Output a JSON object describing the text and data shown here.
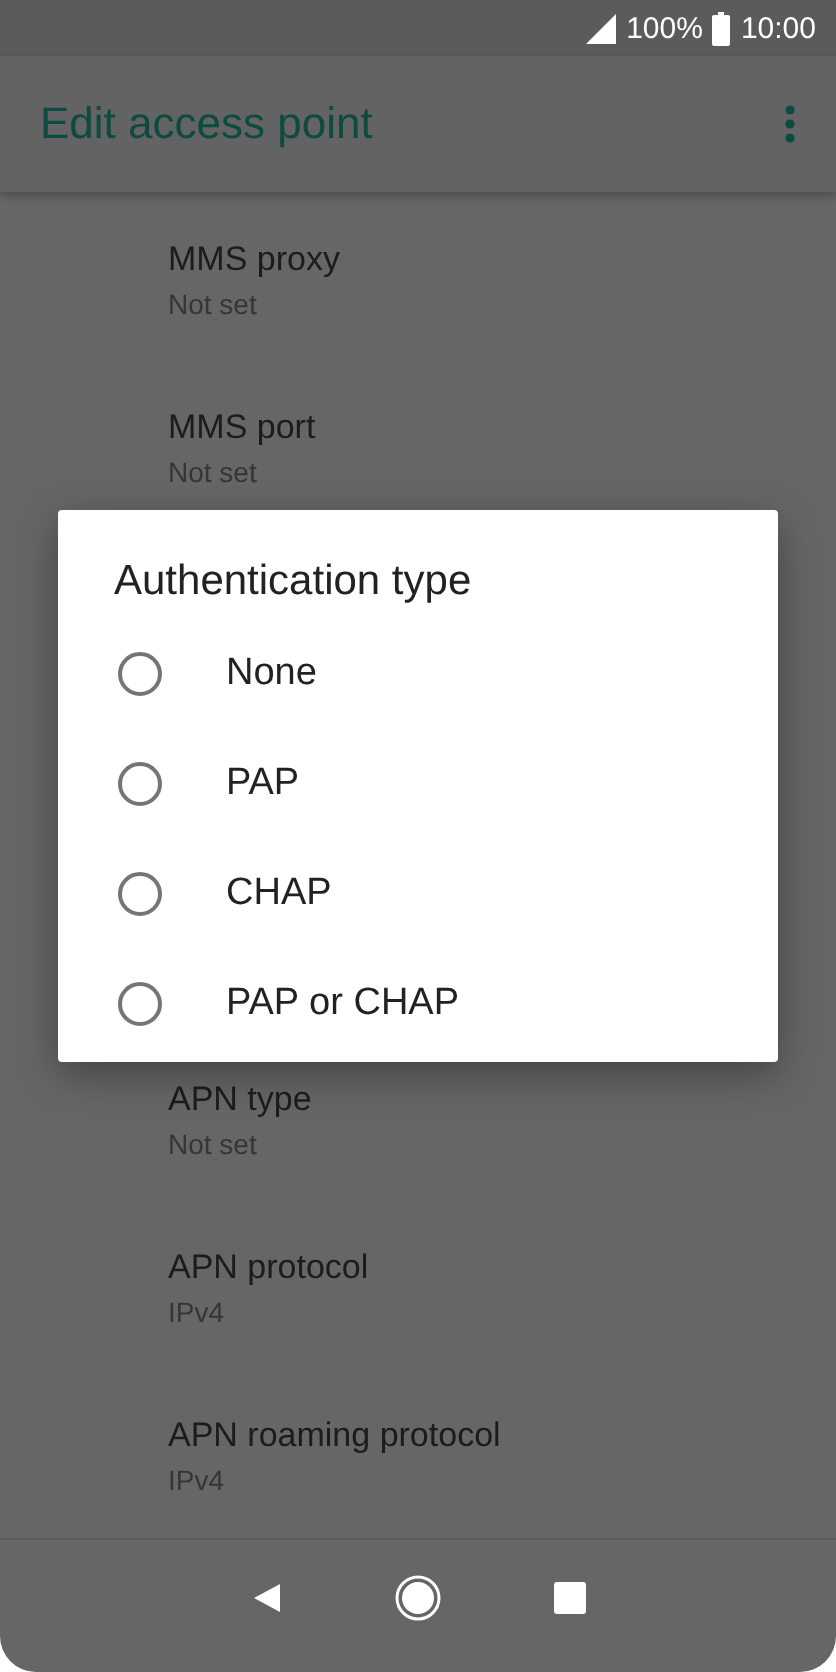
{
  "status_bar": {
    "battery": "100%",
    "time": "10:00"
  },
  "app_bar": {
    "title": "Edit access point"
  },
  "settings": [
    {
      "title": "MMS proxy",
      "value": "Not set"
    },
    {
      "title": "MMS port",
      "value": "Not set"
    }
  ],
  "settings_below": [
    {
      "title": "APN type",
      "value": "Not set"
    },
    {
      "title": "APN protocol",
      "value": "IPv4"
    },
    {
      "title": "APN roaming protocol",
      "value": "IPv4"
    }
  ],
  "dialog": {
    "title": "Authentication type",
    "options": [
      {
        "label": "None",
        "selected": false
      },
      {
        "label": "PAP",
        "selected": false
      },
      {
        "label": "CHAP",
        "selected": false
      },
      {
        "label": "PAP or CHAP",
        "selected": false
      }
    ]
  }
}
